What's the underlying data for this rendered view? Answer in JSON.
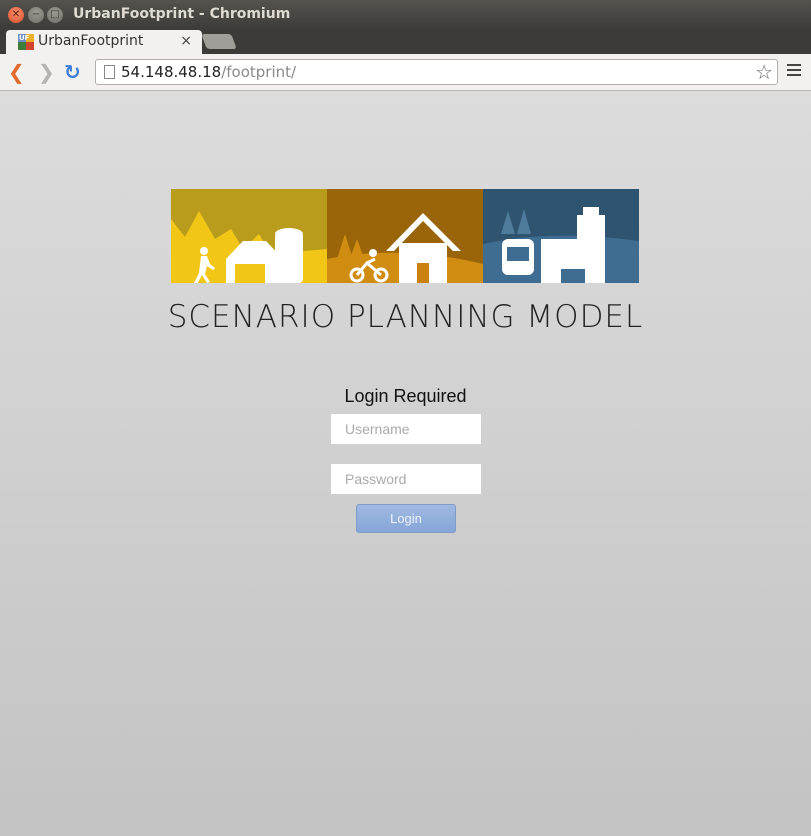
{
  "window": {
    "title": "UrbanFootprint - Chromium"
  },
  "tab": {
    "title": "UrbanFootprint",
    "favicon_text": "UF",
    "close_glyph": "×"
  },
  "toolbar": {
    "url_host": "54.148.48.18",
    "url_path": "/footprint/"
  },
  "page": {
    "headline": "SCENARIO PLANNING MODEL",
    "login_heading": "Login Required",
    "username_placeholder": "Username",
    "password_placeholder": "Password",
    "login_button": "Login"
  },
  "icons": {
    "back": "back-arrow-icon",
    "forward": "forward-arrow-icon",
    "reload": "reload-icon",
    "bookmark": "star-icon",
    "menu": "hamburger-menu-icon"
  },
  "colors": {
    "banner_yellow": "#f2c617",
    "banner_orange": "#c9820f",
    "banner_blue": "#3f6d92",
    "login_button": "#8fadd9"
  }
}
